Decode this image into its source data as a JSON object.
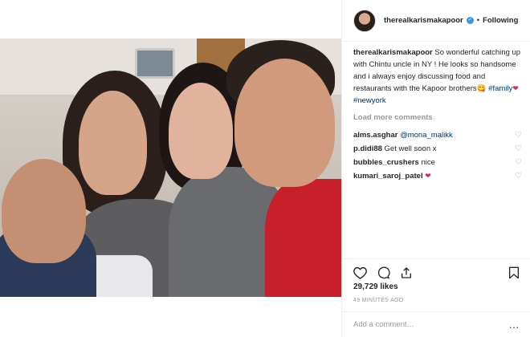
{
  "post": {
    "image_alt": "Group selfie in hospital room"
  },
  "header": {
    "username": "therealkarismakapoor",
    "verified_icon": "verified-badge-icon",
    "separator": "•",
    "follow_label": "Following"
  },
  "caption": {
    "username": "therealkarismakapoor",
    "text": "So wonderful catching up with Chintu uncle in NY ! He looks so handsome and i always enjoy discussing food and restaurants with the Kapoor brothers",
    "emoji": "😋",
    "tag1": "#family",
    "heart": "❤",
    "tag2": "#newyork"
  },
  "load_more": "Load more comments",
  "comments": [
    {
      "user": "alms.asghar",
      "text": "@mona_malikk"
    },
    {
      "user": "p.didi88",
      "text": "Get well soon x"
    },
    {
      "user": "bubbles_crushers",
      "text": "nice"
    },
    {
      "user": "kumari_saroj_patel",
      "text": "❤"
    }
  ],
  "actions": {
    "like_icon": "heart-outline-icon",
    "comment_icon": "comment-bubble-icon",
    "share_icon": "share-icon",
    "save_icon": "bookmark-icon"
  },
  "likes": "29,729 likes",
  "timestamp": "49 MINUTES AGO",
  "add_comment": {
    "placeholder": "Add a comment…",
    "more_icon": "..."
  }
}
